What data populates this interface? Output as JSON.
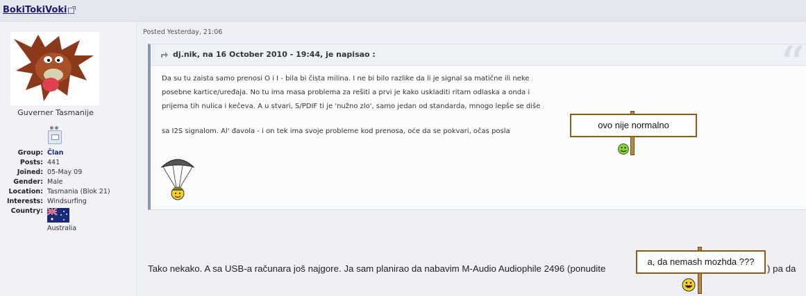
{
  "post": {
    "username": "BokiTokiVoki",
    "member_title": "Guverner Tasmanije",
    "posted": "Posted Yesterday, 21:06"
  },
  "profile": [
    {
      "label": "Group:",
      "value": "Član"
    },
    {
      "label": "Posts:",
      "value": "441"
    },
    {
      "label": "Joined:",
      "value": "05-May 09"
    },
    {
      "label": "Gender:",
      "value": "Male"
    },
    {
      "label": "Location:",
      "value": "Tasmania (Blok 21)"
    },
    {
      "label": "Interests:",
      "value": "Windsurfing"
    },
    {
      "label": "Country:",
      "value": ""
    }
  ],
  "country_name": "Australia",
  "quote": {
    "header": "dj.nik, na 16 October 2010 - 19:44, je napisao :",
    "lines": [
      "Da su tu zaista samo prenosi O i I - bila bi čista milina. I ne bi bilo razlike da li je signal sa matične ili neke",
      "posebne kartice/uređaja. No tu ima masa problema za rešiti a prvi je kako uskladiti ritam odlaska a onda i",
      "prijema tih nulica i kečeva. A u stvari, S/PDIF ti je 'nužno zlo', samo jedan od standarda, mnogo lepše se diše",
      "sa I2S signalom. Al' đavola - i on tek ima svoje probleme kod prenosa, oće da se pokvari, očas posla"
    ],
    "sign_text": "ovo nije normalno"
  },
  "body": {
    "text_before": "Tako nekako. A sa USB-a računara još najgore. Ja sam planirao da nabavim M-Audio Audiophile 2496 (ponudite",
    "sign_text": "a, da nemash mozhda ???",
    "text_after": ") pa da"
  },
  "colors": {
    "username": "#1a1a6a",
    "group": "#1a2a8a",
    "quote_border": "#8c97b3",
    "sign_border": "#8b5a14"
  }
}
